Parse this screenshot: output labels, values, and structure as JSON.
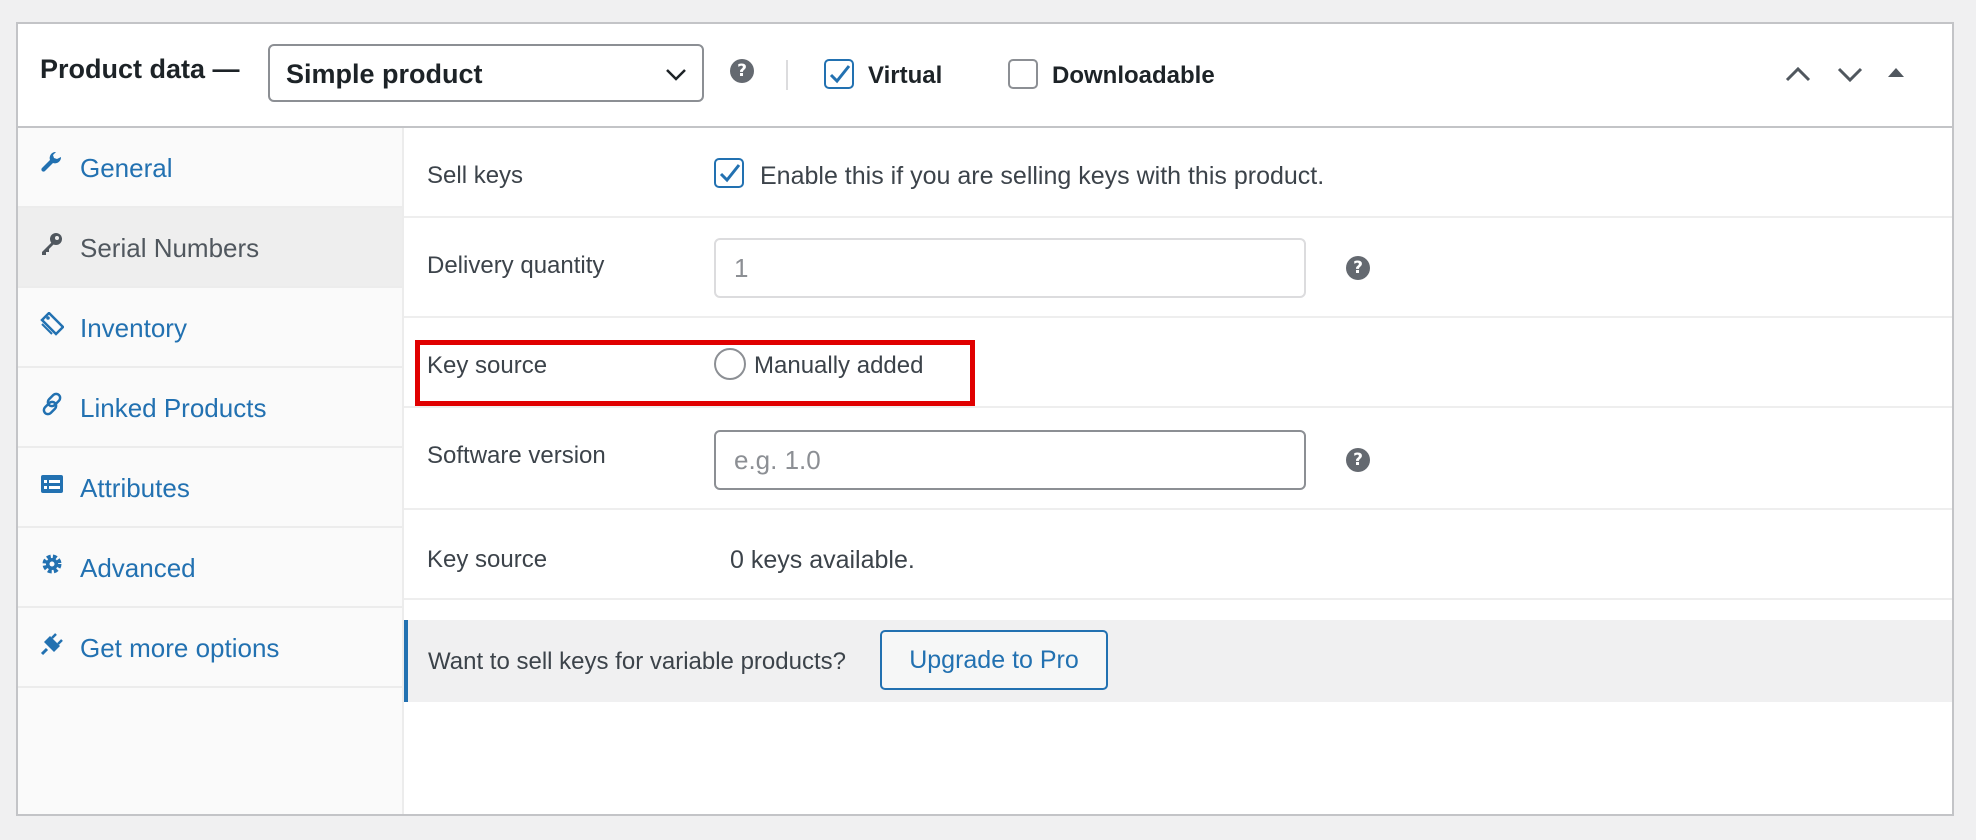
{
  "header": {
    "title": "Product data —",
    "product_type": "Simple product",
    "virtual_label": "Virtual",
    "virtual_checked": true,
    "downloadable_label": "Downloadable",
    "downloadable_checked": false,
    "help_glyph": "?"
  },
  "sidebar": {
    "items": [
      {
        "label": "General",
        "icon": "wrench-icon"
      },
      {
        "label": "Serial Numbers",
        "icon": "key-icon",
        "active": true
      },
      {
        "label": "Inventory",
        "icon": "tag-icon"
      },
      {
        "label": "Linked Products",
        "icon": "link-icon"
      },
      {
        "label": "Attributes",
        "icon": "list-icon"
      },
      {
        "label": "Advanced",
        "icon": "gear-icon"
      },
      {
        "label": "Get more options",
        "icon": "plugin-icon"
      }
    ]
  },
  "form": {
    "sell_keys_label": "Sell keys",
    "sell_keys_text": "Enable this if you are selling keys with this product.",
    "sell_keys_checked": true,
    "delivery_quantity_label": "Delivery quantity",
    "delivery_quantity_placeholder": "1",
    "key_source_label": "Key source",
    "key_source_option": "Manually added",
    "software_version_label": "Software version",
    "software_version_placeholder": "e.g. 1.0",
    "key_source_label_2": "Key source",
    "keys_available": "0 keys available."
  },
  "notice": {
    "text": "Want to sell keys for variable products?",
    "button": "Upgrade to Pro"
  },
  "colors": {
    "accent": "#2271b1",
    "highlight": "#e00000"
  }
}
